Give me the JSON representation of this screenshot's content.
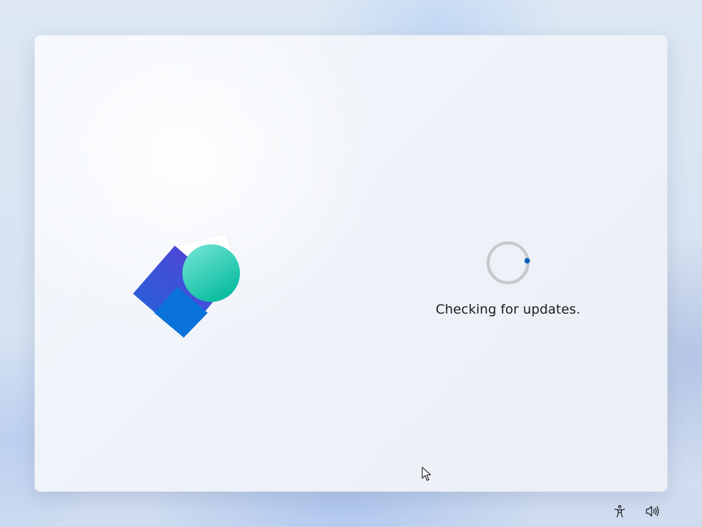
{
  "status": {
    "message": "Checking for updates."
  },
  "spinner": {
    "track_color": "#c8c9cc",
    "dot_color": "#0a5fb8"
  },
  "illustration": {
    "shapes": [
      "white-card",
      "blue-diamond",
      "teal-circle"
    ],
    "colors": {
      "card": "#ffffff",
      "diamond_start": "#1f66d9",
      "diamond_end": "#5a3fd8",
      "diamond_inner": "#0a73d9",
      "circle_start": "#6fe3d3",
      "circle_end": "#00b99a"
    }
  },
  "tray": {
    "accessibility_icon": "accessibility-icon",
    "volume_icon": "volume-icon"
  }
}
